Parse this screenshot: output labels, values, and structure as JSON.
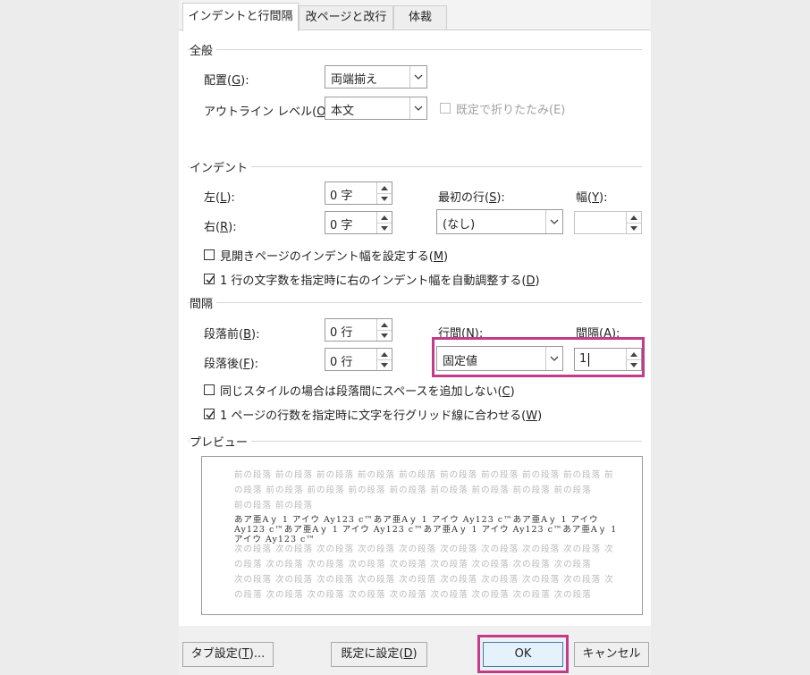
{
  "tabs": [
    {
      "label": "インデントと行間隔"
    },
    {
      "label": "改ページと改行"
    },
    {
      "label": "体裁"
    }
  ],
  "general": {
    "title": "全般",
    "alignment": {
      "label": "配置(",
      "key": "G",
      "suffix": "):",
      "value": "両端揃え"
    },
    "outline": {
      "label": "アウトライン レベル(",
      "key": "O",
      "suffix": "):",
      "value": "本文"
    },
    "collapse": {
      "label": "既定で折りたたみ(E)",
      "checked": false,
      "disabled": true
    }
  },
  "indent": {
    "title": "インデント",
    "left": {
      "label": "左(",
      "key": "L",
      "suffix": "):",
      "value": "0 字"
    },
    "right": {
      "label": "右(",
      "key": "R",
      "suffix": "):",
      "value": "0 字"
    },
    "first_line": {
      "label": "最初の行(",
      "key": "S",
      "suffix": "):",
      "value": "(なし)"
    },
    "width": {
      "label": "幅(",
      "key": "Y",
      "suffix": "):",
      "value": ""
    },
    "mirror": {
      "label": "見開きページのインデント幅を設定する(",
      "key": "M",
      "suffix": ")",
      "checked": false
    },
    "auto_adjust": {
      "label": "1 行の文字数を指定時に右のインデント幅を自動調整する(",
      "key": "D",
      "suffix": ")",
      "checked": true
    }
  },
  "spacing": {
    "title": "間隔",
    "before": {
      "label": "段落前(",
      "key": "B",
      "suffix": "):",
      "value": "0 行"
    },
    "after": {
      "label": "段落後(",
      "key": "F",
      "suffix": "):",
      "value": "0 行"
    },
    "line_spacing": {
      "label": "行間(N):",
      "value": "固定値"
    },
    "at": {
      "label": "間隔(A):",
      "value": "1"
    },
    "no_space_same_style": {
      "label": "同じスタイルの場合は段落間にスペースを追加しない(",
      "key": "C",
      "suffix": ")",
      "checked": false
    },
    "snap_grid": {
      "label": "1 ページの行数を指定時に文字を行グリッド線に合わせる(",
      "key": "W",
      "suffix": ")",
      "checked": true
    }
  },
  "preview": {
    "title": "プレビュー",
    "prev_lines": [
      "前の段落 前の段落 前の段落 前の段落 前の段落 前の段落 前の段落 前の段落 前の段落 前",
      "の段落 前の段落 前の段落 前の段落 前の段落 前の段落 前の段落 前の段落 前の段落",
      "前の段落 前の段落"
    ],
    "sample_lines": [
      "あア亜Aｙ 1 アイウ Ay123 c™あア亜Aｙ 1 アイウ Ay123 c™あア亜Aｙ 1 アイウ",
      "Ay123 c™あア亜Aｙ 1 アイウ Ay123 c™あア亜Aｙ 1 アイウ Ay123 c™あア亜Aｙ 1",
      "アイウ Ay123 c™"
    ],
    "next_lines": [
      "次の段落 次の段落 次の段落 次の段落 次の段落 次の段落 次の段落 次の段落 次の段落 次",
      "の段落 次の段落 次の段落 次の段落 次の段落 次の段落 次の段落 次の段落 次の段落",
      "次の段落 次の段落 次の段落 次の段落 次の段落 次の段落 次の段落 次の段落 次の段落 次",
      "の段落 次の段落 次の段落 次の段落 次の段落 次の段落 次の段落 次の段落 次の段落"
    ]
  },
  "buttons": {
    "tabs_label": "タブ設定(",
    "tabs_key": "T",
    "tabs_suffix": ")...",
    "default_label": "既定に設定(",
    "default_key": "D",
    "default_suffix": ")",
    "ok_label": "OK",
    "cancel_label": "キャンセル"
  },
  "colors": {
    "highlight": "#c23c8a",
    "ok_border": "#3c7fb1"
  }
}
